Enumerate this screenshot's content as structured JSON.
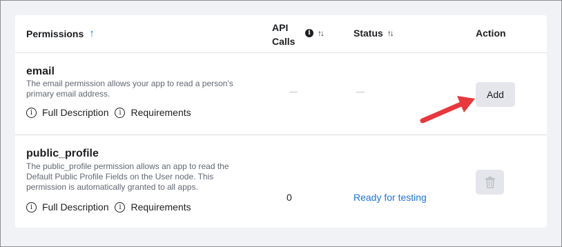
{
  "table": {
    "headers": {
      "permissions": "Permissions",
      "api_calls_line1": "API",
      "api_calls_line2": "Calls",
      "status": "Status",
      "action": "Action"
    },
    "header_icons": {
      "permissions_sort": "arrow-up-icon",
      "api_info": "info-icon",
      "api_sort": "sort-icon",
      "status_sort": "sort-icon"
    },
    "rows": [
      {
        "name": "email",
        "description": "The email permission allows your app to read a person's primary email address.",
        "full_description_label": "Full Description",
        "requirements_label": "Requirements",
        "api_calls": "—",
        "status": "—",
        "action_label": "Add"
      },
      {
        "name": "public_profile",
        "description": "The public_profile permission allows an app to read the Default Public Profile Fields on the User node. This permission is automatically granted to all apps.",
        "full_description_label": "Full Description",
        "requirements_label": "Requirements",
        "api_calls": "0",
        "status": "Ready for testing",
        "action_icon": "trash-icon"
      }
    ]
  },
  "annotation": {
    "icon": "red-arrow-icon",
    "color": "#e8383d"
  },
  "colors": {
    "accent": "#1877f2",
    "link": "#1b74e4",
    "button_bg": "#e4e6eb"
  }
}
